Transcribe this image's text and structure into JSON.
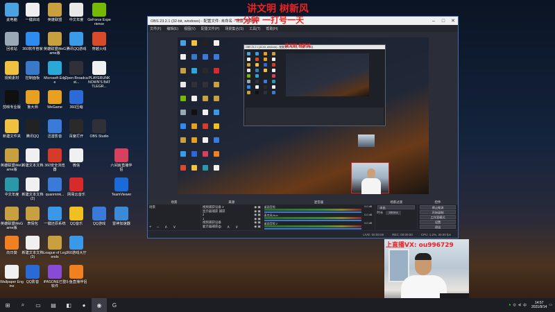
{
  "desktop_icons": [
    {
      "label": "此电脑",
      "color": "#4aa3e0"
    },
    {
      "label": "一键启动",
      "color": "#eeeeee"
    },
    {
      "label": "英雄联盟",
      "color": "#c8a040"
    },
    {
      "label": "中文年度",
      "color": "#e8e8e8"
    },
    {
      "label": "GeForce Experience",
      "color": "#76b900"
    },
    {
      "label": "回收站",
      "color": "#9aa8b8"
    },
    {
      "label": "360软件管家",
      "color": "#2d8cf0"
    },
    {
      "label": "英雄联盟WeGame版",
      "color": "#c8a040"
    },
    {
      "label": "腾讯QQ游戏",
      "color": "#3a9be8"
    },
    {
      "label": "穿越火线",
      "color": "#d84a2a"
    },
    {
      "label": "视频素材",
      "color": "#f0c040"
    },
    {
      "label": "控制面板",
      "color": "#3a78c8"
    },
    {
      "label": "Microsoft Edge",
      "color": "#2aa8d8"
    },
    {
      "label": "Open Broadcast...",
      "color": "#303038"
    },
    {
      "label": "PLAYERUNKNOWN'S BATTLEGR...",
      "color": "#f0f0f0"
    },
    {
      "label": "剪映专业版",
      "color": "#101010"
    },
    {
      "label": "鲁大师",
      "color": "#e8a020"
    },
    {
      "label": "WeGame",
      "color": "#e8a020"
    },
    {
      "label": "360压缩",
      "color": "#2d6ad8"
    },
    {
      "label": "新建文件夹",
      "color": "#f0c040"
    },
    {
      "label": "腾讯QQ",
      "color": "#222222"
    },
    {
      "label": "迅雷影音",
      "color": "#3a7ad8"
    },
    {
      "label": "百度打开",
      "color": "#2a2a2a"
    },
    {
      "label": "OBS Studio",
      "color": "#303038"
    },
    {
      "label": "英雄联盟WeGame版",
      "color": "#c8a040"
    },
    {
      "label": "新建文本文档",
      "color": "#f0f0f0"
    },
    {
      "label": "360安全浏览器",
      "color": "#d83a2a"
    },
    {
      "label": "微信",
      "color": "#f0f0f0"
    },
    {
      "label": "六间房直播伴侣",
      "color": "#d84060"
    },
    {
      "label": "中文年度",
      "color": "#2a98a8"
    },
    {
      "label": "新建文本文档 (2)",
      "color": "#f0f0f0"
    },
    {
      "label": "quanmink...",
      "color": "#3a7ad8"
    },
    {
      "label": "网易云音乐",
      "color": "#d82a2a"
    },
    {
      "label": "英雄联盟WeGame版",
      "color": "#c8a040"
    },
    {
      "label": "表情包",
      "color": "#c8a040"
    },
    {
      "label": "一键还原系统",
      "color": "#3a98e8"
    },
    {
      "label": "QQ音乐",
      "color": "#f0c020"
    },
    {
      "label": "QQ游戏",
      "color": "#3a7ad8"
    },
    {
      "label": "向日葵",
      "color": "#f08020"
    },
    {
      "label": "新建文本文档 (3)",
      "color": "#f0f0f0"
    },
    {
      "label": "League of Legends",
      "color": "#c8a040"
    },
    {
      "label": "360游戏大厅",
      "color": "#3a98e8"
    },
    {
      "label": "Wallpaper Engine",
      "color": "#f0f0f0"
    },
    {
      "label": "QQ影音",
      "color": "#2a6ad8"
    },
    {
      "label": "iPASONE已登软件",
      "color": "#8a4ad8"
    },
    {
      "label": "斗鱼直播伴侣",
      "color": "#f08020"
    },
    {
      "label": "TeamViewer",
      "color": "#1a6ad8"
    },
    {
      "label": "雷神加速器",
      "color": "#3a8ad8"
    }
  ],
  "obs": {
    "title": "OBS 23.2.1 (32-bit, windows) - 配置文件: 未命名 - 场景: 未命名",
    "menu": [
      "文件(F)",
      "编辑(E)",
      "视图(V)",
      "配置文件(P)",
      "场景集合(S)",
      "工具(T)",
      "帮助(H)"
    ],
    "docks": {
      "scenes": {
        "header": "场景",
        "items": [
          "场景"
        ]
      },
      "sources": {
        "header": "来源",
        "items": [
          "视频捕获设备 2",
          "显示器捕获 捕获",
          "2",
          "1",
          "视频捕获设备",
          "显示器捕获"
        ]
      },
      "mixer": {
        "header": "混音器",
        "channels": [
          {
            "label": "桌面音频",
            "db": "0.0 dB"
          },
          {
            "label": "麦克风/Aux",
            "db": "0.0 dB"
          },
          {
            "label": "桌面音频 2",
            "db": "0.0 dB"
          }
        ]
      },
      "transitions": {
        "header": "场景过渡",
        "type": "淡出",
        "duration_label": "时长",
        "duration": "300ms"
      },
      "controls": {
        "header": "控件",
        "buttons": [
          "停止推流",
          "开始录制",
          "工作室模式",
          "设置",
          "退出"
        ]
      }
    },
    "status": {
      "live": "LIVE: 00:00:00",
      "rec": "REC: 00:00:00",
      "cpu": "CPU: 1.2%, 30.00 fps"
    }
  },
  "overlay_text": {
    "line1": "讲文明 树新风",
    "line2": "一分钟 一打号一天"
  },
  "nested_overlay": "讲文明 树新风",
  "webcam_caption": "上直播VX: ou996729",
  "taskbar": {
    "items": [
      "⊞",
      "⌕",
      "▭",
      "▤",
      "◧",
      "●",
      "◉",
      "G"
    ],
    "time": "14:57",
    "date": "2021/9/14"
  }
}
